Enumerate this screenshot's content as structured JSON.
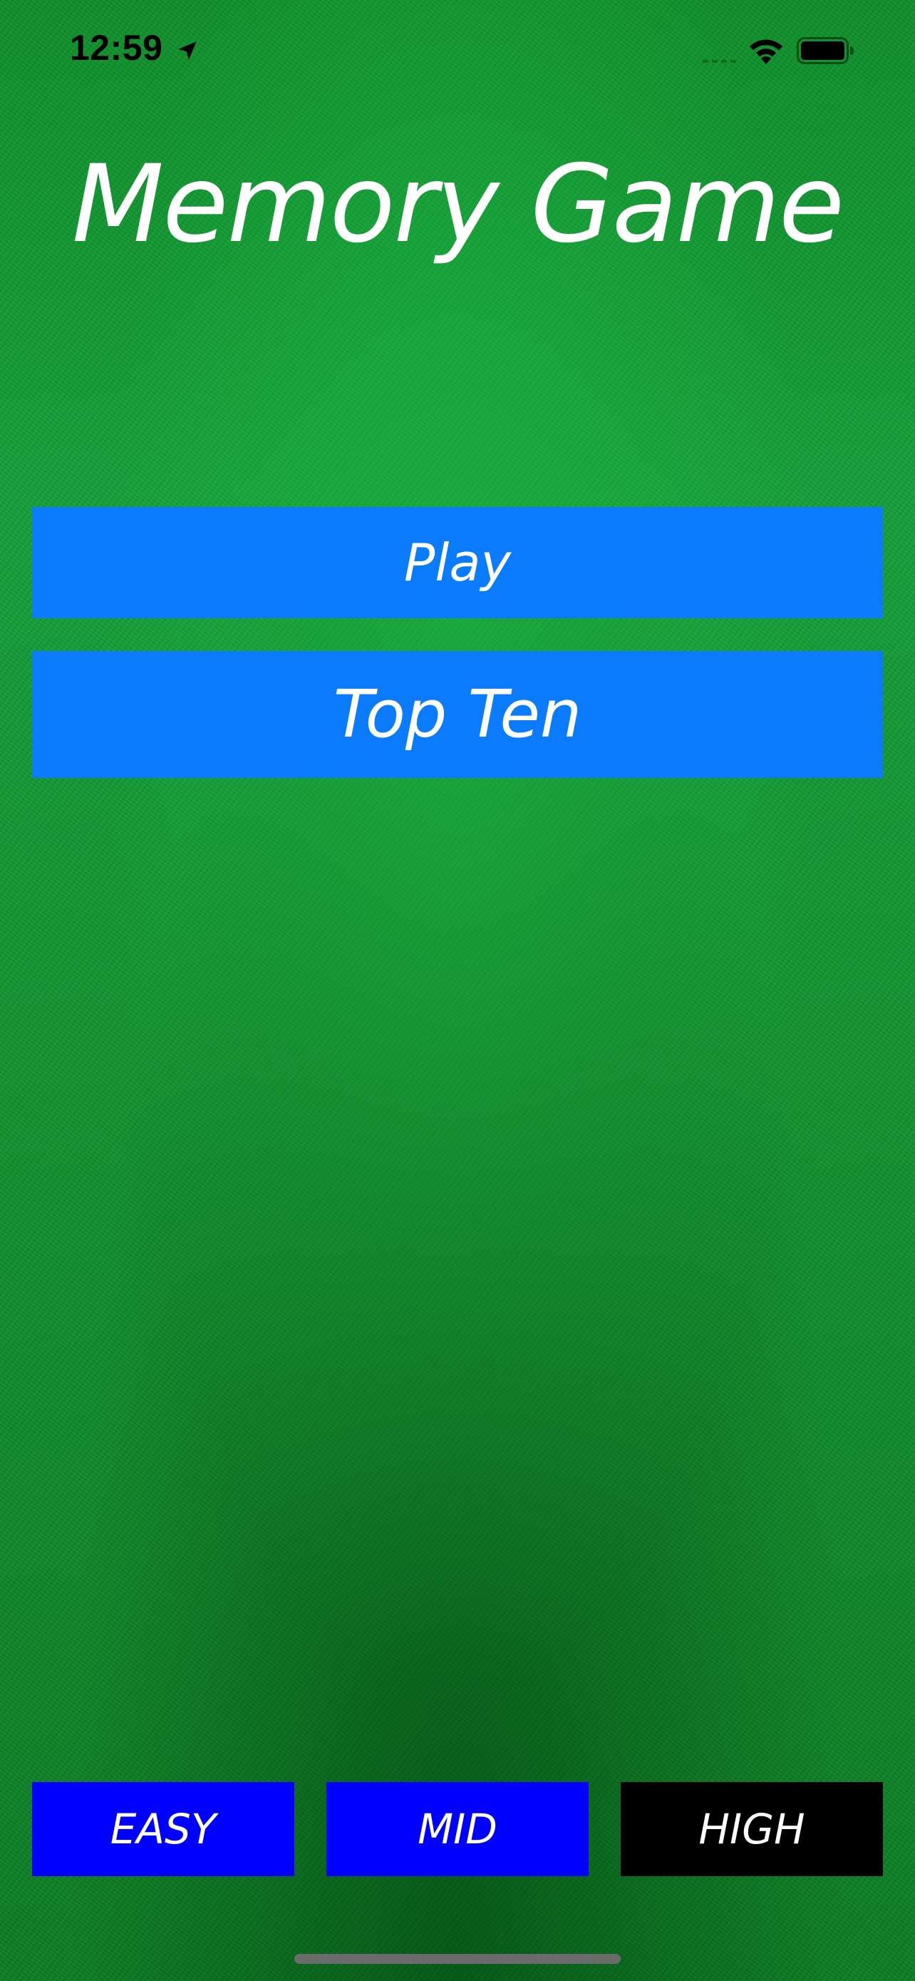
{
  "status_bar": {
    "time": "12:59",
    "icons": [
      "location-arrow-icon",
      "cellular-signal-icon",
      "wifi-icon",
      "battery-icon"
    ],
    "text_color": "#000000"
  },
  "title": "Memory Game",
  "menu": {
    "play_label": "Play",
    "top_ten_label": "Top Ten",
    "button_color": "#0a7bfd"
  },
  "levels": [
    {
      "label": "EASY",
      "color": "#0000ff"
    },
    {
      "label": "MID",
      "color": "#0000ff"
    },
    {
      "label": "HIGH",
      "color": "#000000",
      "selected": true
    }
  ],
  "background": {
    "texture": "green felt",
    "color": "#13922f"
  }
}
